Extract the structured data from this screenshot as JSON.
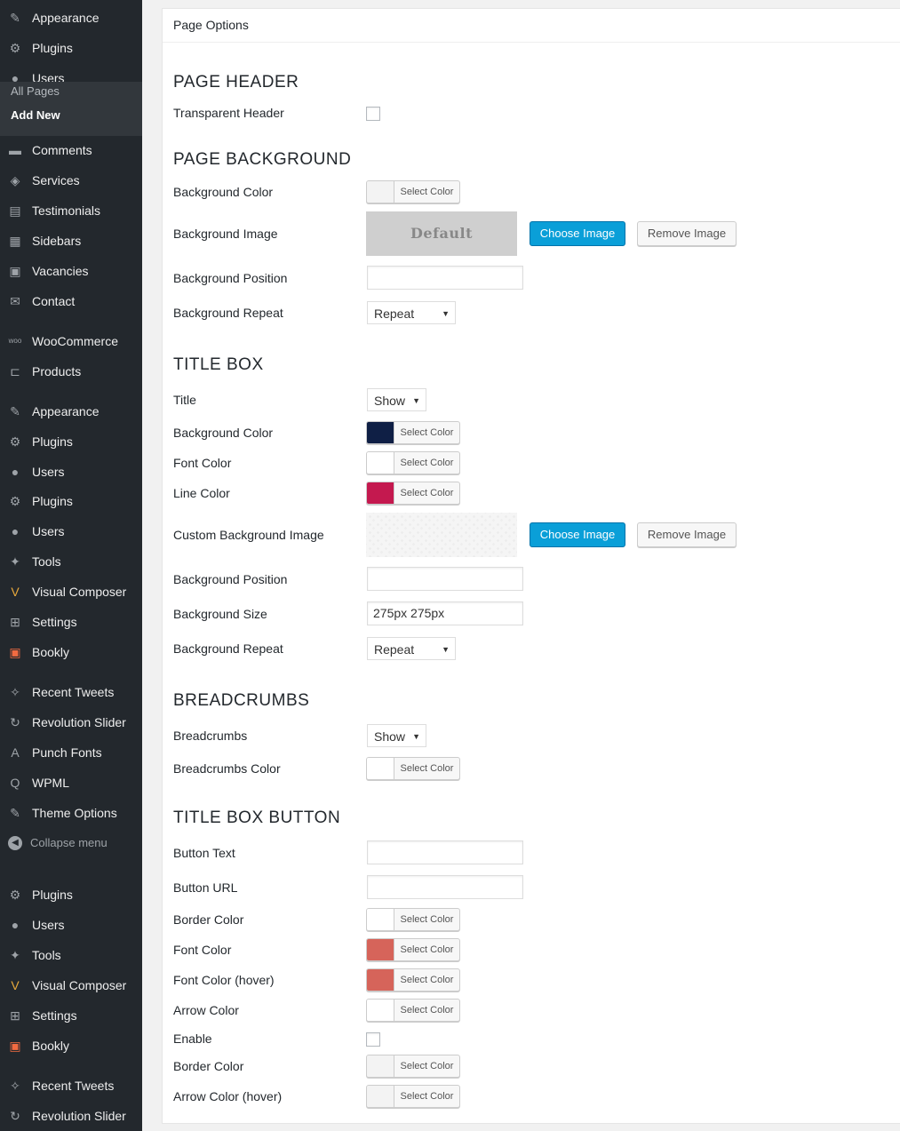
{
  "sidebar": {
    "items": [
      {
        "label": "Appearance",
        "icon": "paintbrush-icon"
      },
      {
        "label": "Plugins",
        "icon": "plugin-icon"
      },
      {
        "label": "Users",
        "icon": "user-icon"
      },
      {
        "label": "Comments",
        "icon": "comments-icon"
      },
      {
        "label": "Services",
        "icon": "tag-icon"
      },
      {
        "label": "Testimonials",
        "icon": "testimonial-icon"
      },
      {
        "label": "Sidebars",
        "icon": "grid-icon"
      },
      {
        "label": "Vacancies",
        "icon": "vacancies-icon"
      },
      {
        "label": "Contact",
        "icon": "mail-icon"
      },
      {
        "label": "WooCommerce",
        "icon": "woo-icon"
      },
      {
        "label": "Products",
        "icon": "cart-icon"
      },
      {
        "label": "Appearance",
        "icon": "paintbrush-icon"
      },
      {
        "label": "Plugins",
        "icon": "plugin-icon"
      },
      {
        "label": "Users",
        "icon": "user-icon"
      },
      {
        "label": "Plugins",
        "icon": "plugin-icon"
      },
      {
        "label": "Users",
        "icon": "user-icon"
      },
      {
        "label": "Tools",
        "icon": "wrench-icon"
      },
      {
        "label": "Visual Composer",
        "icon": "visual-composer-icon"
      },
      {
        "label": "Settings",
        "icon": "settings-icon"
      },
      {
        "label": "Bookly",
        "icon": "bookly-icon"
      },
      {
        "label": "Recent Tweets",
        "icon": "twitter-icon"
      },
      {
        "label": "Revolution Slider",
        "icon": "refresh-icon"
      },
      {
        "label": "Punch Fonts",
        "icon": "font-icon"
      },
      {
        "label": "WPML",
        "icon": "wpml-icon"
      },
      {
        "label": "Theme Options",
        "icon": "hammer-icon"
      },
      {
        "label": "Collapse menu",
        "icon": "collapse-icon"
      },
      {
        "label": "Plugins",
        "icon": "plugin-icon"
      },
      {
        "label": "Users",
        "icon": "user-icon"
      },
      {
        "label": "Tools",
        "icon": "wrench-icon"
      },
      {
        "label": "Visual Composer",
        "icon": "visual-composer-icon"
      },
      {
        "label": "Settings",
        "icon": "settings-icon"
      },
      {
        "label": "Bookly",
        "icon": "bookly-icon"
      },
      {
        "label": "Recent Tweets",
        "icon": "twitter-icon"
      },
      {
        "label": "Revolution Slider",
        "icon": "refresh-icon"
      }
    ],
    "submenu": {
      "all_pages": "All Pages",
      "add_new": "Add New"
    }
  },
  "panel": {
    "title": "Page Options",
    "select_color_label": "Select Color",
    "choose_image_label": "Choose Image",
    "remove_image_label": "Remove Image",
    "default_image_text": "Default",
    "page_header": {
      "title": "PAGE HEADER",
      "transparent_header": "Transparent Header"
    },
    "page_background": {
      "title": "PAGE BACKGROUND",
      "background_color": "Background Color",
      "background_image": "Background Image",
      "background_position": "Background Position",
      "background_repeat": "Background Repeat",
      "repeat_value": "Repeat"
    },
    "title_box": {
      "title": "TITLE BOX",
      "title_label": "Title",
      "title_value": "Show",
      "background_color": "Background Color",
      "font_color": "Font Color",
      "line_color": "Line Color",
      "custom_background_image": "Custom Background Image",
      "background_position": "Background Position",
      "background_size": "Background Size",
      "background_size_value": "275px 275px",
      "background_repeat": "Background Repeat",
      "repeat_value": "Repeat"
    },
    "breadcrumbs": {
      "title": "BREADCRUMBS",
      "breadcrumbs_label": "Breadcrumbs",
      "breadcrumbs_value": "Show",
      "breadcrumbs_color": "Breadcrumbs Color"
    },
    "title_box_button": {
      "title": "TITLE BOX BUTTON",
      "button_text": "Button Text",
      "button_url": "Button URL",
      "border_color": "Border Color",
      "font_color": "Font Color",
      "font_color_hover": "Font Color (hover)",
      "arrow_color": "Arrow Color",
      "enable": "Enable",
      "border_color_2": "Border Color",
      "arrow_color_hover": "Arrow Color (hover)"
    }
  },
  "colors": {
    "sidebar_bg": "#23282d",
    "accent_blue": "#0a9fd8",
    "title_box_background": "#0f1f45",
    "line_color": "#c4194f",
    "button_font_color": "#d6645a",
    "button_font_color_hover": "#d6645a",
    "empty_swatch": "#ffffff",
    "neutral_swatch": "#f3f3f3"
  }
}
